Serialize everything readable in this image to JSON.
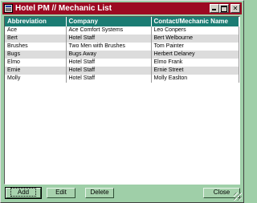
{
  "window": {
    "title": "Hotel PM // Mechanic List",
    "icons": {
      "app": "app-icon",
      "minimize": "minimize-icon",
      "maximize": "maximize-icon",
      "close": "close-icon"
    },
    "close_glyph": "✕"
  },
  "table": {
    "columns": [
      "Abbreviation",
      "Company",
      "Contact/Mechanic Name"
    ],
    "rows": [
      [
        "Ace",
        "Ace Comfort Systems",
        "Leo Conpers"
      ],
      [
        "Bert",
        "Hotel Staff",
        "Bert Welbourne"
      ],
      [
        "Brushes",
        "Two Men with Brushes",
        "Tom Painter"
      ],
      [
        "Bugs",
        "Bugs Away",
        "Herbert Delaney"
      ],
      [
        "Elmo",
        "Hotel Staff",
        "Elmo Frank"
      ],
      [
        "Ernie",
        "Hotel Staff",
        "Ernie Street"
      ],
      [
        "Molly",
        "Hotel Staff",
        "Molly Easlton"
      ]
    ]
  },
  "buttons": {
    "add": "Add",
    "edit": "Edit",
    "delete": "Delete",
    "close": "Close"
  },
  "colors": {
    "titlebar": "#9c0a22",
    "header": "#1b7c73",
    "background": "#9fcfa8",
    "alt_row": "#dcdcdc"
  }
}
